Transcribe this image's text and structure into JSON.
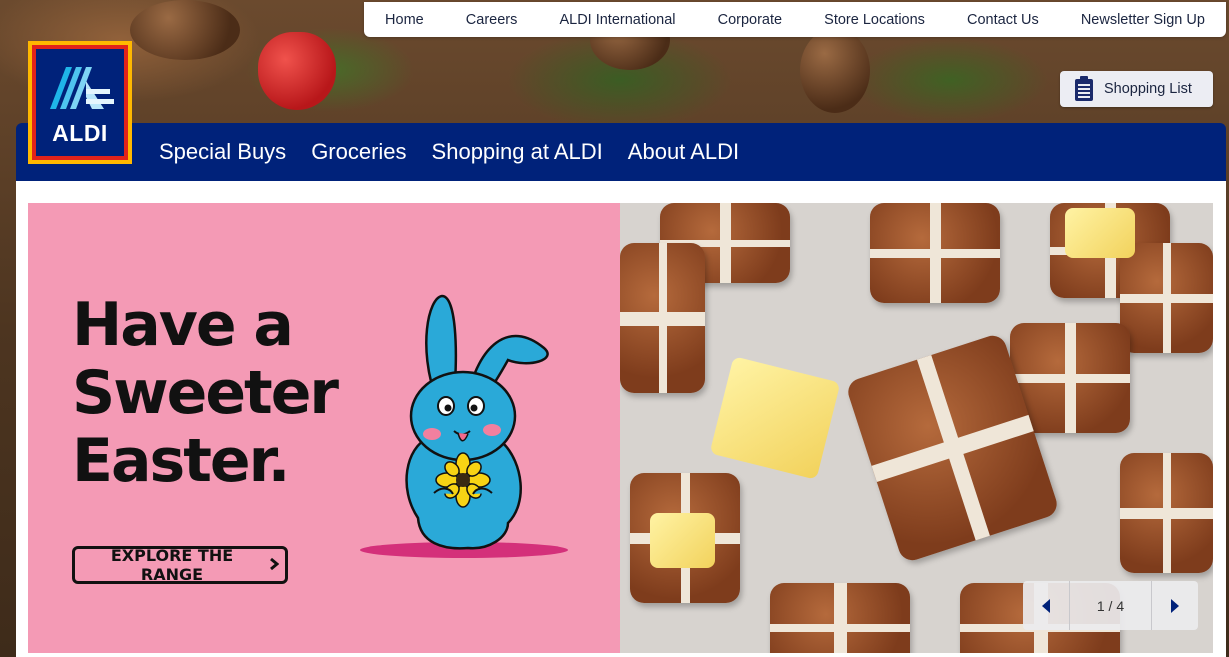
{
  "top_nav": {
    "links": [
      "Home",
      "Careers",
      "ALDI International",
      "Corporate",
      "Store Locations",
      "Contact Us",
      "Newsletter Sign Up"
    ]
  },
  "shopping_list": {
    "label": "Shopping List",
    "icon": "clipboard-icon"
  },
  "logo": {
    "text": "ALDI"
  },
  "main_nav": {
    "items": [
      "Special Buys",
      "Groceries",
      "Shopping at ALDI",
      "About ALDI"
    ]
  },
  "banner": {
    "headline_lines": [
      "Have a",
      "Sweeter",
      "Easter."
    ],
    "cta_label": "EXPLORE THE RANGE",
    "cta_icon": "chevron-right-icon",
    "background_color": "#f49ab5"
  },
  "carousel": {
    "counter": "1 / 4",
    "prev_icon": "caret-left-icon",
    "next_icon": "caret-right-icon"
  },
  "colors": {
    "brand_blue": "#00227a",
    "brand_orange": "#ffb800",
    "brand_red": "#e2231a"
  }
}
